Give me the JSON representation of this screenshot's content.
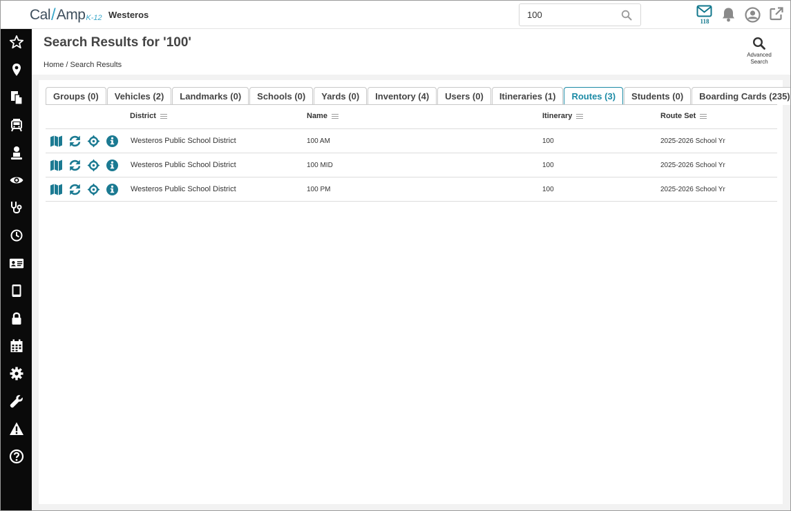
{
  "header": {
    "logo_text_left": "Cal",
    "logo_text_right": "Amp",
    "logo_suffix": "K-12",
    "org_name": "Westeros",
    "search_value": "100",
    "mail_count": "118"
  },
  "sidebar": {
    "items": [
      {
        "icon": "star-icon"
      },
      {
        "icon": "map-pin-icon"
      },
      {
        "icon": "documents-icon"
      },
      {
        "icon": "bus-icon"
      },
      {
        "icon": "student-icon"
      },
      {
        "icon": "eye-icon"
      },
      {
        "icon": "stethoscope-icon"
      },
      {
        "icon": "clock-icon"
      },
      {
        "icon": "id-card-icon"
      },
      {
        "icon": "tablet-icon"
      },
      {
        "icon": "lock-icon"
      },
      {
        "icon": "calendar-icon"
      },
      {
        "icon": "gear-icon"
      },
      {
        "icon": "wrench-icon"
      },
      {
        "icon": "warning-icon"
      },
      {
        "icon": "help-icon"
      }
    ]
  },
  "page": {
    "title": "Search Results for '100'",
    "breadcrumb_home": "Home",
    "breadcrumb_sep": "/",
    "breadcrumb_current": "Search Results",
    "advanced_search_line1": "Advanced",
    "advanced_search_line2": "Search"
  },
  "tabs": [
    {
      "label": "Groups (0)"
    },
    {
      "label": "Vehicles (2)"
    },
    {
      "label": "Landmarks (0)"
    },
    {
      "label": "Schools (0)"
    },
    {
      "label": "Yards (0)"
    },
    {
      "label": "Inventory (4)"
    },
    {
      "label": "Users (0)"
    },
    {
      "label": "Itineraries (1)"
    },
    {
      "label": "Routes (3)",
      "active": true
    },
    {
      "label": "Students (0)"
    },
    {
      "label": "Boarding Cards (235)"
    }
  ],
  "table": {
    "columns": [
      "District",
      "Name",
      "Itinerary",
      "Route Set"
    ],
    "rows": [
      {
        "district": "Westeros Public School District",
        "name": "100 AM",
        "itinerary": "100",
        "route_set": "2025-2026 School Yr"
      },
      {
        "district": "Westeros Public School District",
        "name": "100 MID",
        "itinerary": "100",
        "route_set": "2025-2026 School Yr"
      },
      {
        "district": "Westeros Public School District",
        "name": "100 PM",
        "itinerary": "100",
        "route_set": "2025-2026 School Yr"
      }
    ]
  },
  "colors": {
    "accent": "#1b8aa5",
    "sidebar_bg": "#0a0a0a",
    "action_icon": "#1b7a92"
  }
}
